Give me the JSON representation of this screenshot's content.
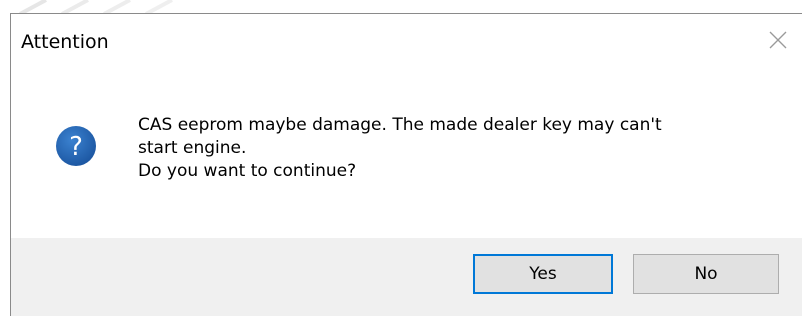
{
  "dialog": {
    "title": "Attention",
    "close_icon": "close-icon",
    "icon": "question-icon",
    "message_lines": [
      "CAS eeprom maybe damage. The made dealer key may can't",
      "start engine.",
      "Do you want to continue?"
    ],
    "buttons": {
      "yes_label": "Yes",
      "no_label": "No"
    }
  },
  "colors": {
    "question_icon": "#1d5fa8",
    "default_button_border": "#0078d7",
    "footer_background": "#f0f0f0"
  }
}
